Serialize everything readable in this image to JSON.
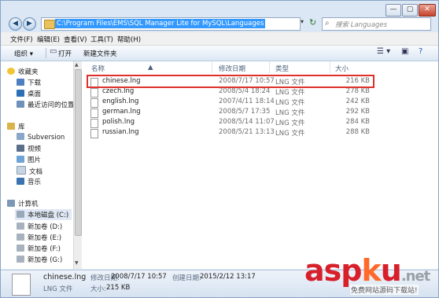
{
  "window": {
    "controls": {
      "minimize": "—",
      "maximize": "▢",
      "close": "✕"
    },
    "address_path": "C:\\Program Files\\EMS\\SQL Manager Lite for MySQL\\Languages",
    "search_placeholder": "搜索 Languages"
  },
  "menu": [
    "文件(F)",
    "编辑(E)",
    "查看(V)",
    "工具(T)",
    "帮助(H)"
  ],
  "toolbar": {
    "organize": "组织 ▾",
    "open": "打开",
    "new_folder": "新建文件夹"
  },
  "nav": {
    "favorites": "收藏夹",
    "downloads": "下载",
    "desktop": "桌面",
    "recent": "最近访问的位置",
    "libraries": "库",
    "subversion": "Subversion",
    "videos": "视频",
    "pictures": "图片",
    "documents": "文档",
    "music": "音乐",
    "computer": "计算机",
    "drive_c": "本地磁盘 (C:)",
    "drive_d": "新加卷 (D:)",
    "drive_e": "新加卷 (E:)",
    "drive_f": "新加卷 (F:)",
    "drive_g": "新加卷 (G:)"
  },
  "columns": {
    "name": "名称",
    "date": "修改日期",
    "type": "类型",
    "size": "大小"
  },
  "files": [
    {
      "name": "chinese.lng",
      "date": "2008/7/17 10:57",
      "type": "LNG 文件",
      "size": "216 KB"
    },
    {
      "name": "czech.lng",
      "date": "2008/5/4 18:24",
      "type": "LNG 文件",
      "size": "278 KB"
    },
    {
      "name": "english.lng",
      "date": "2007/4/11 18:14",
      "type": "LNG 文件",
      "size": "242 KB"
    },
    {
      "name": "german.lng",
      "date": "2008/5/7 17:35",
      "type": "LNG 文件",
      "size": "292 KB"
    },
    {
      "name": "polish.lng",
      "date": "2008/5/14 11:07",
      "type": "LNG 文件",
      "size": "284 KB"
    },
    {
      "name": "russian.lng",
      "date": "2008/5/21 13:13",
      "type": "LNG 文件",
      "size": "288 KB"
    }
  ],
  "details": {
    "name": "chinese.lng",
    "modified_label": "修改日期:",
    "modified": "2008/7/17 10:57",
    "created_label": "创建日期:",
    "created": "2015/2/12 13:17",
    "type": "LNG 文件",
    "size_label": "大小:",
    "size": "215 KB"
  },
  "watermark": {
    "a": "asp",
    "k": "k",
    "u": "u",
    "net": ".net",
    "sub": "免费网站源码下载站!"
  }
}
